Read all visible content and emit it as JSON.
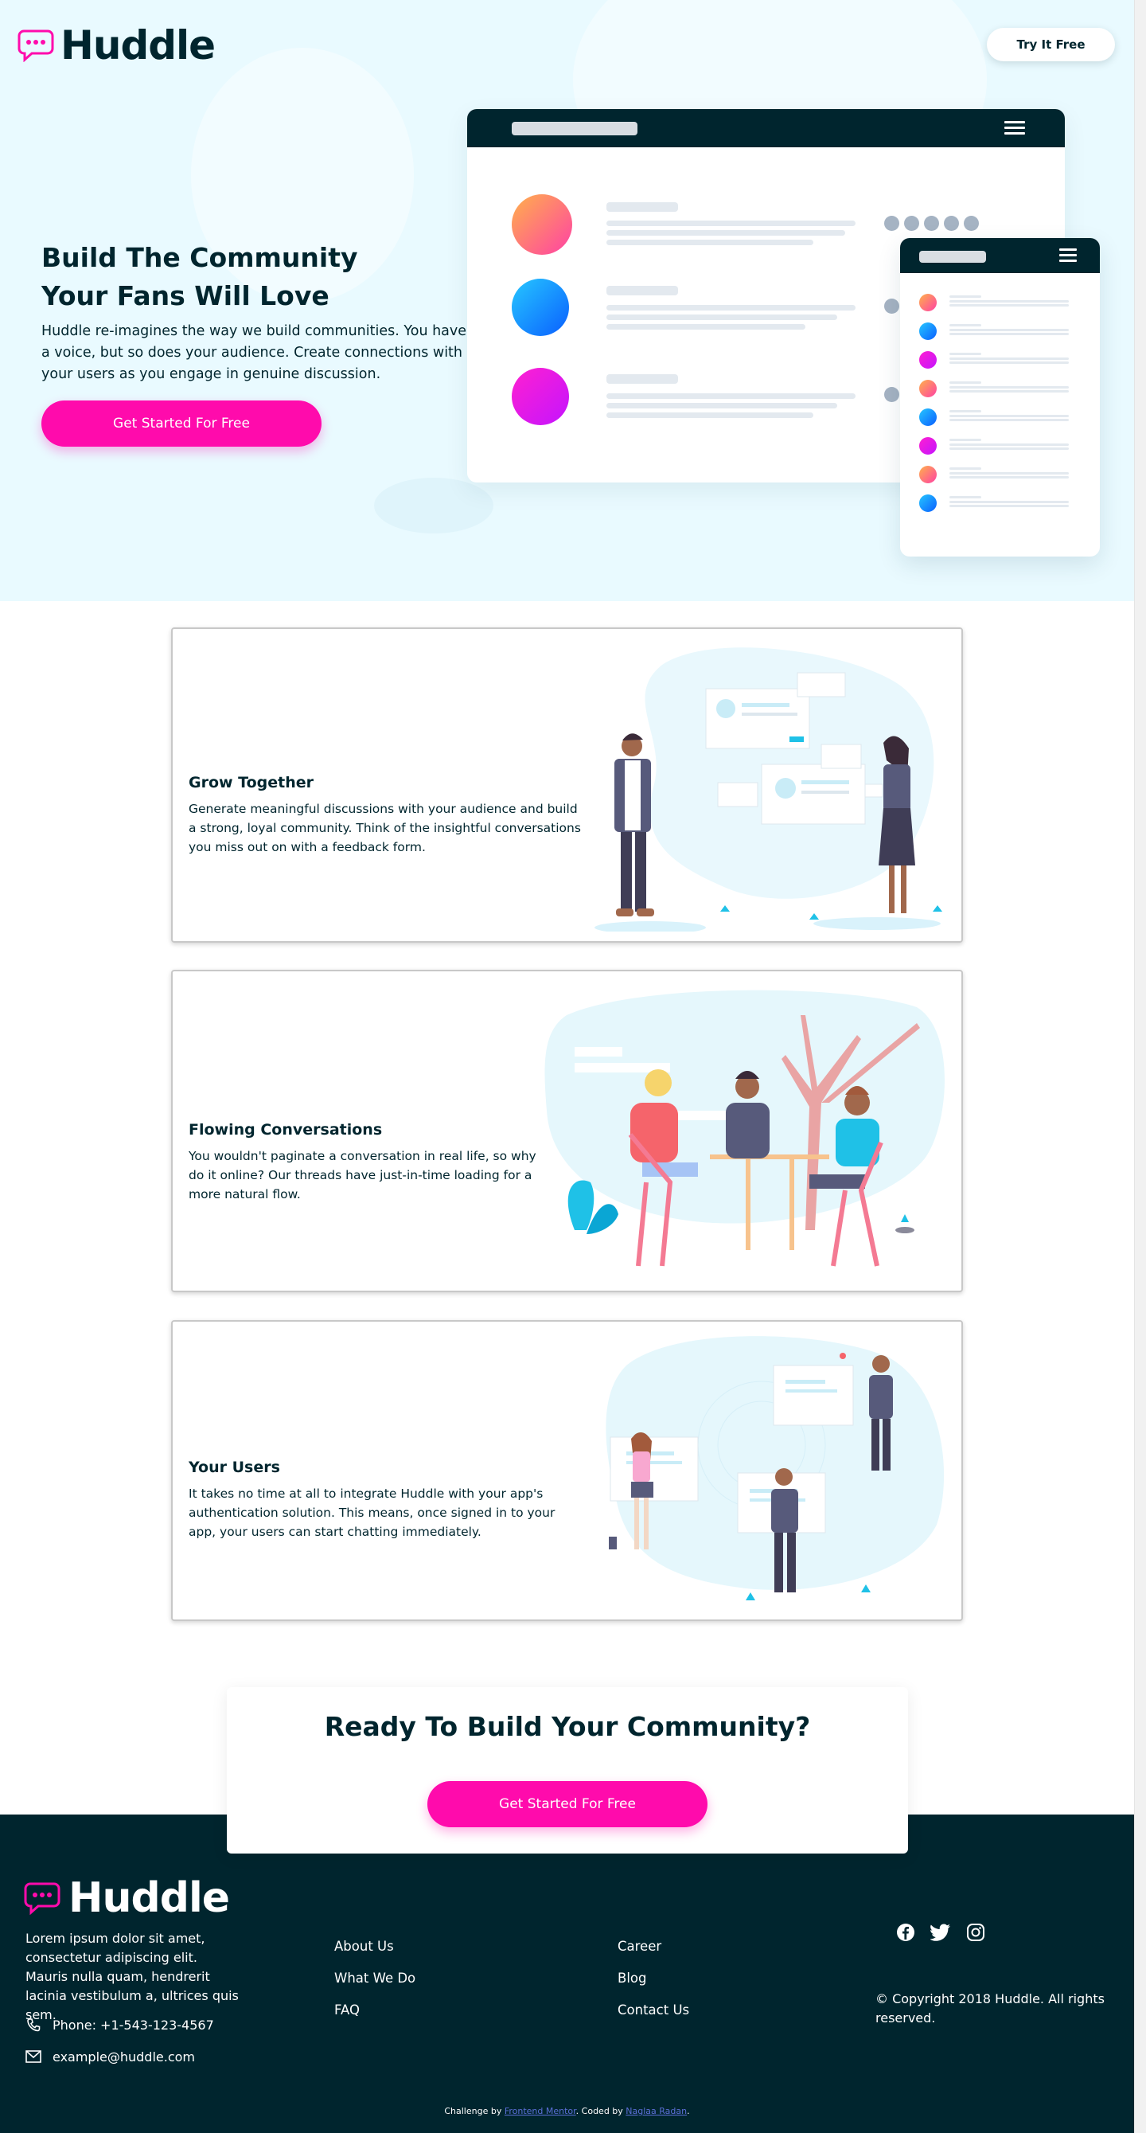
{
  "header": {
    "brand": "Huddle",
    "try_button": "Try It Free"
  },
  "hero": {
    "title_line1": "Build The Community",
    "title_line2": "Your Fans Will Love",
    "description": "Huddle re-imagines the way we build communities. You have a voice, but so does your audience. Create connections with your users as you engage in genuine discussion.",
    "cta": "Get Started For Free"
  },
  "features": [
    {
      "title": "Grow Together",
      "description": "Generate meaningful discussions with your audience and build a strong, loyal community. Think of the insightful conversations you miss out on with a feedback form."
    },
    {
      "title": "Flowing Conversations",
      "description": "You wouldn't paginate a conversation in real life, so why do it online? Our threads have just-in-time loading for a more natural flow."
    },
    {
      "title": "Your Users",
      "description": "It takes no time at all to integrate Huddle with your app's authentication solution. This means, once signed in to your app, your users can start chatting immediately."
    }
  ],
  "ready": {
    "title": "Ready To Build Your Community?",
    "cta": "Get Started For Free"
  },
  "footer": {
    "brand": "Huddle",
    "description": "Lorem ipsum dolor sit amet, consectetur adipiscing elit. Mauris nulla quam, hendrerit lacinia vestibulum a, ultrices quis sem.",
    "phone": "Phone: +1-543-123-4567",
    "email": "example@huddle.com",
    "links_col1": [
      "About Us",
      "What We Do",
      "FAQ"
    ],
    "links_col2": [
      "Career",
      "Blog",
      "Contact Us"
    ],
    "socials": [
      "facebook-icon",
      "twitter-icon",
      "instagram-icon"
    ],
    "copyright": "© Copyright 2018 Huddle. All rights reserved.",
    "attribution": {
      "prefix": "Challenge by ",
      "link1": "Frontend Mentor",
      "middle": ". Coded by ",
      "link2": "Naglaa Radan",
      "suffix": "."
    }
  },
  "colors": {
    "dark": "#00252e",
    "pink": "#ff0bac",
    "hero_bg": "#e9faff"
  }
}
